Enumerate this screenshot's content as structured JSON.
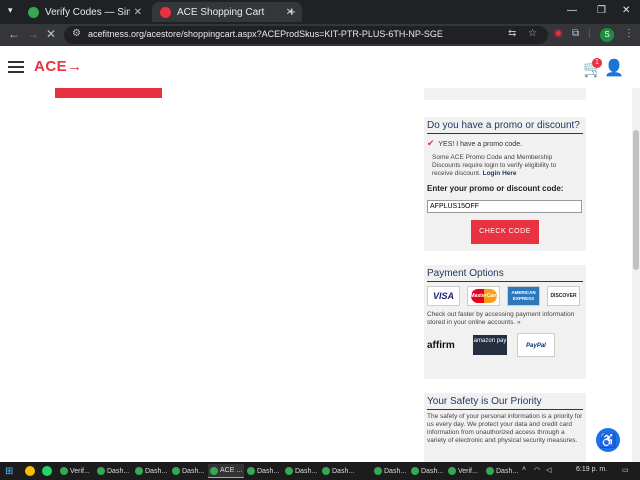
{
  "browser": {
    "tabs": [
      {
        "title": "Verify Codes — SimplyCodes",
        "favicon_color": "#34a853"
      },
      {
        "title": "ACE Shopping Cart",
        "favicon_color": "#e8323f"
      }
    ],
    "url": "acefitness.org/acestore/shoppingcart.aspx?ACEProdSkus=KIT-PTR-PLUS-6TH-NP-SGE",
    "profile_initial": "S"
  },
  "site": {
    "logo_text": "ACE→",
    "cart_count": "1"
  },
  "promo": {
    "title": "Do you have a promo or discount?",
    "checkbox_label": "YES!  I have a promo code.",
    "note": "Some ACE Promo Code and Membership Discounts require login to verify eligibility to receive discount.",
    "login_link": "Login Here",
    "input_label": "Enter your promo or discount code:",
    "input_value": "AFPLUS15OFF",
    "button_label": "CHECK CODE"
  },
  "payment": {
    "title": "Payment Options",
    "cards": [
      "VISA",
      "MasterCard",
      "AMERICAN EXPRESS",
      "DISCOVER"
    ],
    "text": "Check out faster by accessing payment information stored in your online accounts. »",
    "wallets": {
      "affirm": "affirm",
      "amazon": "amazon pay",
      "paypal": "PayPal"
    }
  },
  "safety": {
    "title": "Your Safety is Our Priority",
    "text": "The safety of your personal information is a priority for us every day. We protect your data and credit card information from unauthorized access through a variety of electronic and physical security measures."
  },
  "taskbar": {
    "items": [
      "Verif...",
      "Dash...",
      "Dash...",
      "Dash...",
      "ACE ...",
      "Dash...",
      "Dash...",
      "Dash...",
      "Dash...",
      "Dash...",
      "Verif...",
      "Dash..."
    ],
    "time": "6:19 p. m."
  }
}
